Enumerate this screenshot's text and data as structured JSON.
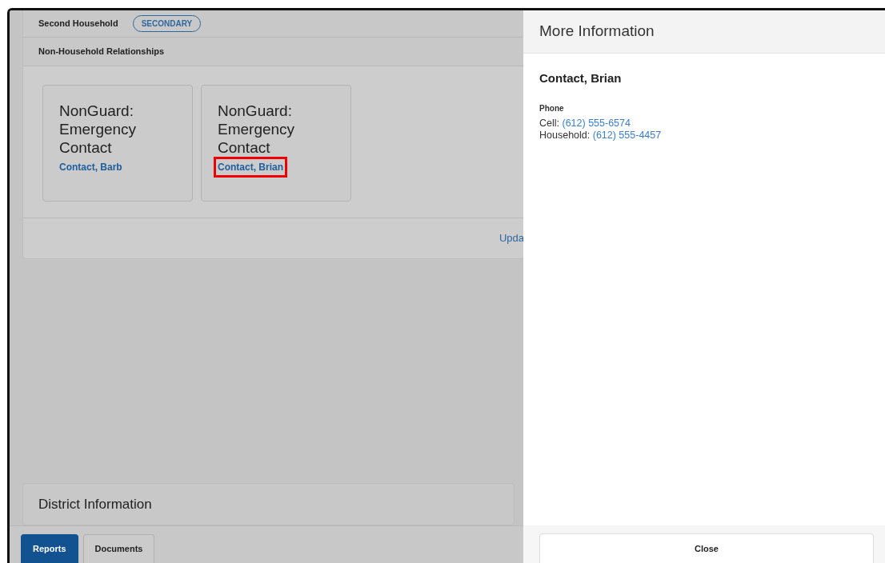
{
  "household": {
    "name": "Second Household",
    "badge": "SECONDARY"
  },
  "section_title": "Non-Household Relationships",
  "relationships": [
    {
      "role": "NonGuard: Emergency Contact",
      "contact": "Contact, Barb",
      "highlighted": false
    },
    {
      "role": "NonGuard: Emergency Contact",
      "contact": "Contact, Brian",
      "highlighted": true
    }
  ],
  "update_link": "Upda",
  "district_title": "District Information",
  "bottom_tabs": [
    {
      "label": "Reports",
      "selected": true
    },
    {
      "label": "Documents",
      "selected": false
    }
  ],
  "panel": {
    "title": "More Information",
    "name": "Contact, Brian",
    "section": "Phone",
    "phones": [
      {
        "label": "Cell:",
        "number": "(612) 555-6574"
      },
      {
        "label": "Household:",
        "number": "(612) 555-4457"
      }
    ],
    "close": "Close"
  }
}
